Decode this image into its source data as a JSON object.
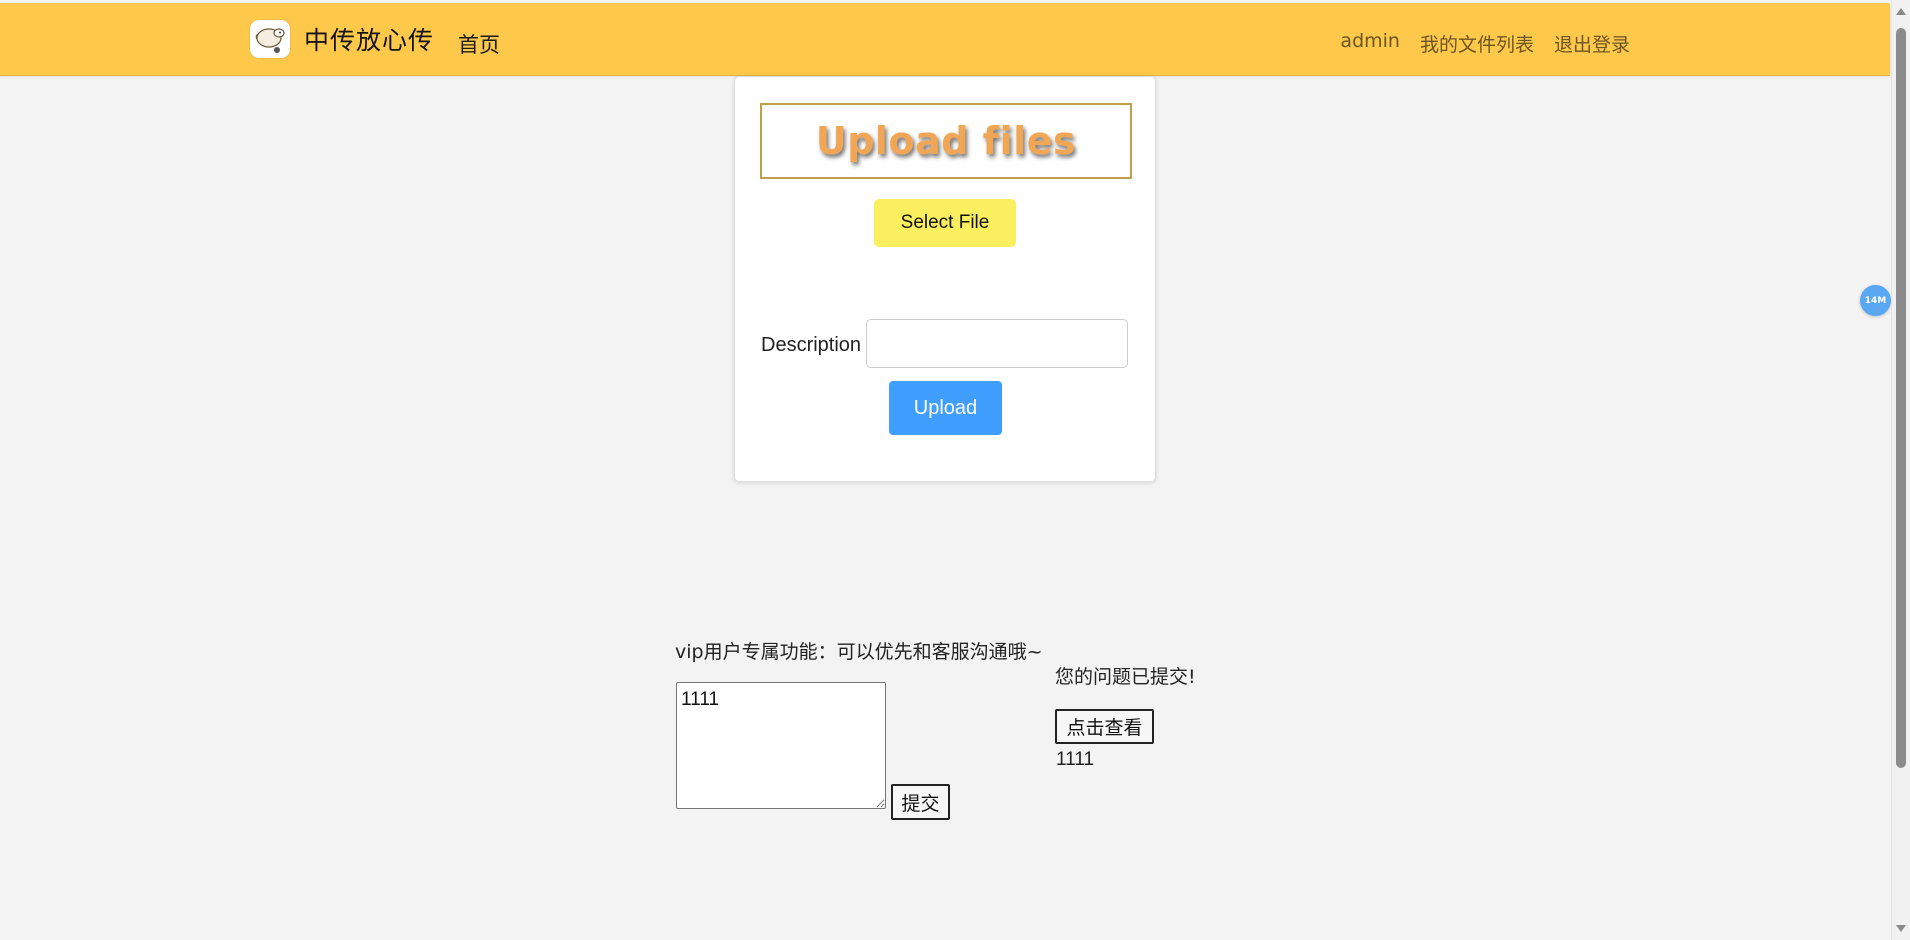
{
  "navbar": {
    "brand_title": "中传放心传",
    "home_label": "首页",
    "user_label": "admin",
    "file_list_label": "我的文件列表",
    "logout_label": "退出登录"
  },
  "upload_card": {
    "title": "Upload files",
    "select_file_label": "Select File",
    "description_label": "Description",
    "description_value": "",
    "upload_label": "Upload"
  },
  "vip": {
    "label": "vip用户专属功能：可以优先和客服沟通哦~",
    "question_value": "1111",
    "submit_label": "提交",
    "submitted_message": "您的问题已提交!",
    "view_label": "点击查看",
    "answer_text": "1111"
  },
  "floating_badge": {
    "label": "14M"
  },
  "colors": {
    "navbar_bg": "#fec84b",
    "select_btn_bg": "#fbef5f",
    "upload_btn_bg": "#409eff",
    "title_color": "#f1a656"
  }
}
